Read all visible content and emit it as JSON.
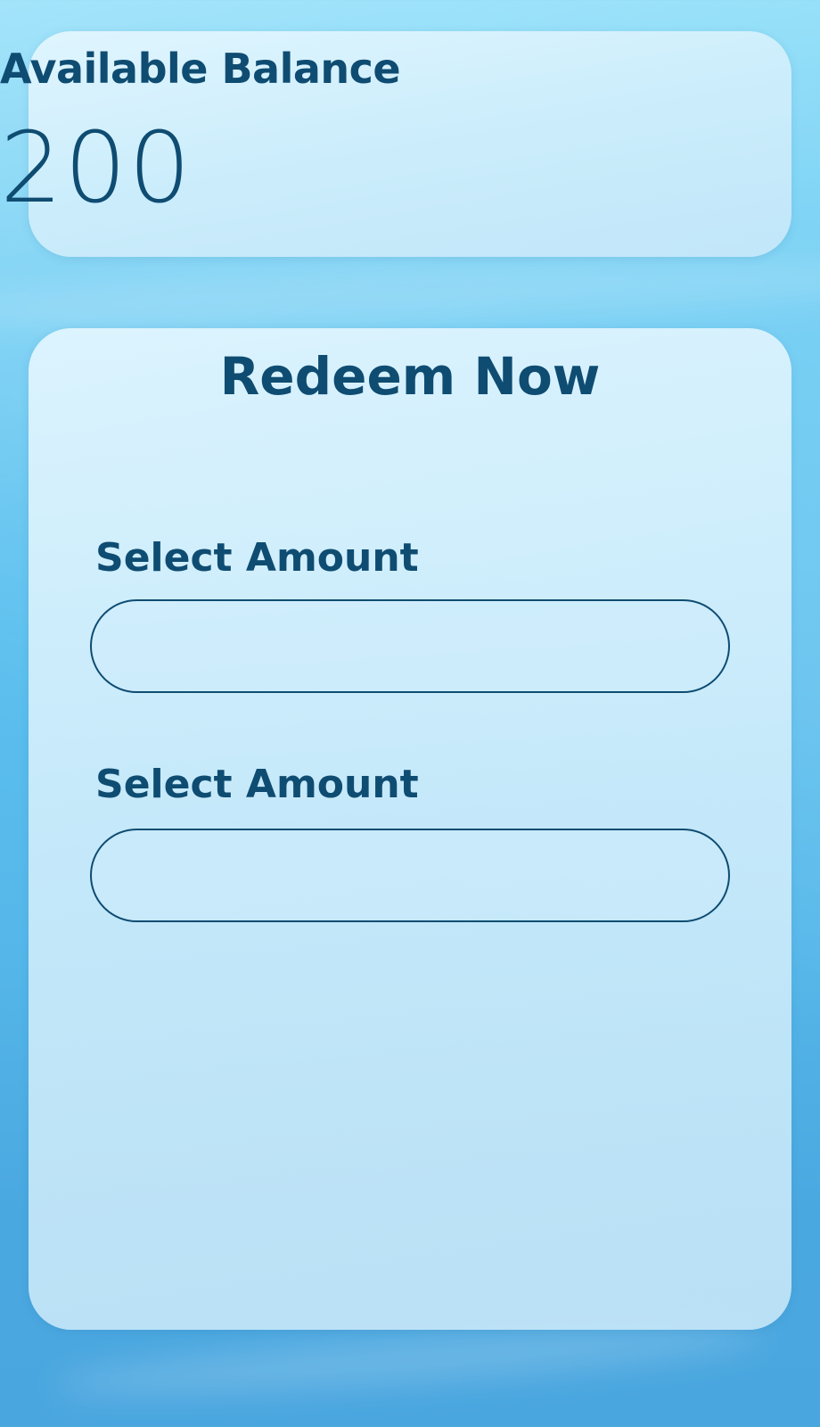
{
  "balance": {
    "title": "Available Balance",
    "value": "200"
  },
  "redeem": {
    "title": "Redeem Now",
    "fields": [
      {
        "label": "Select Amount",
        "value": "",
        "placeholder": ""
      },
      {
        "label": "Select Amount",
        "value": "",
        "placeholder": ""
      }
    ]
  },
  "colors": {
    "text": "#0f4c72",
    "background_top": "#7fd9f8",
    "background_bottom": "#4aa6df",
    "card": "#d6f0fc"
  }
}
